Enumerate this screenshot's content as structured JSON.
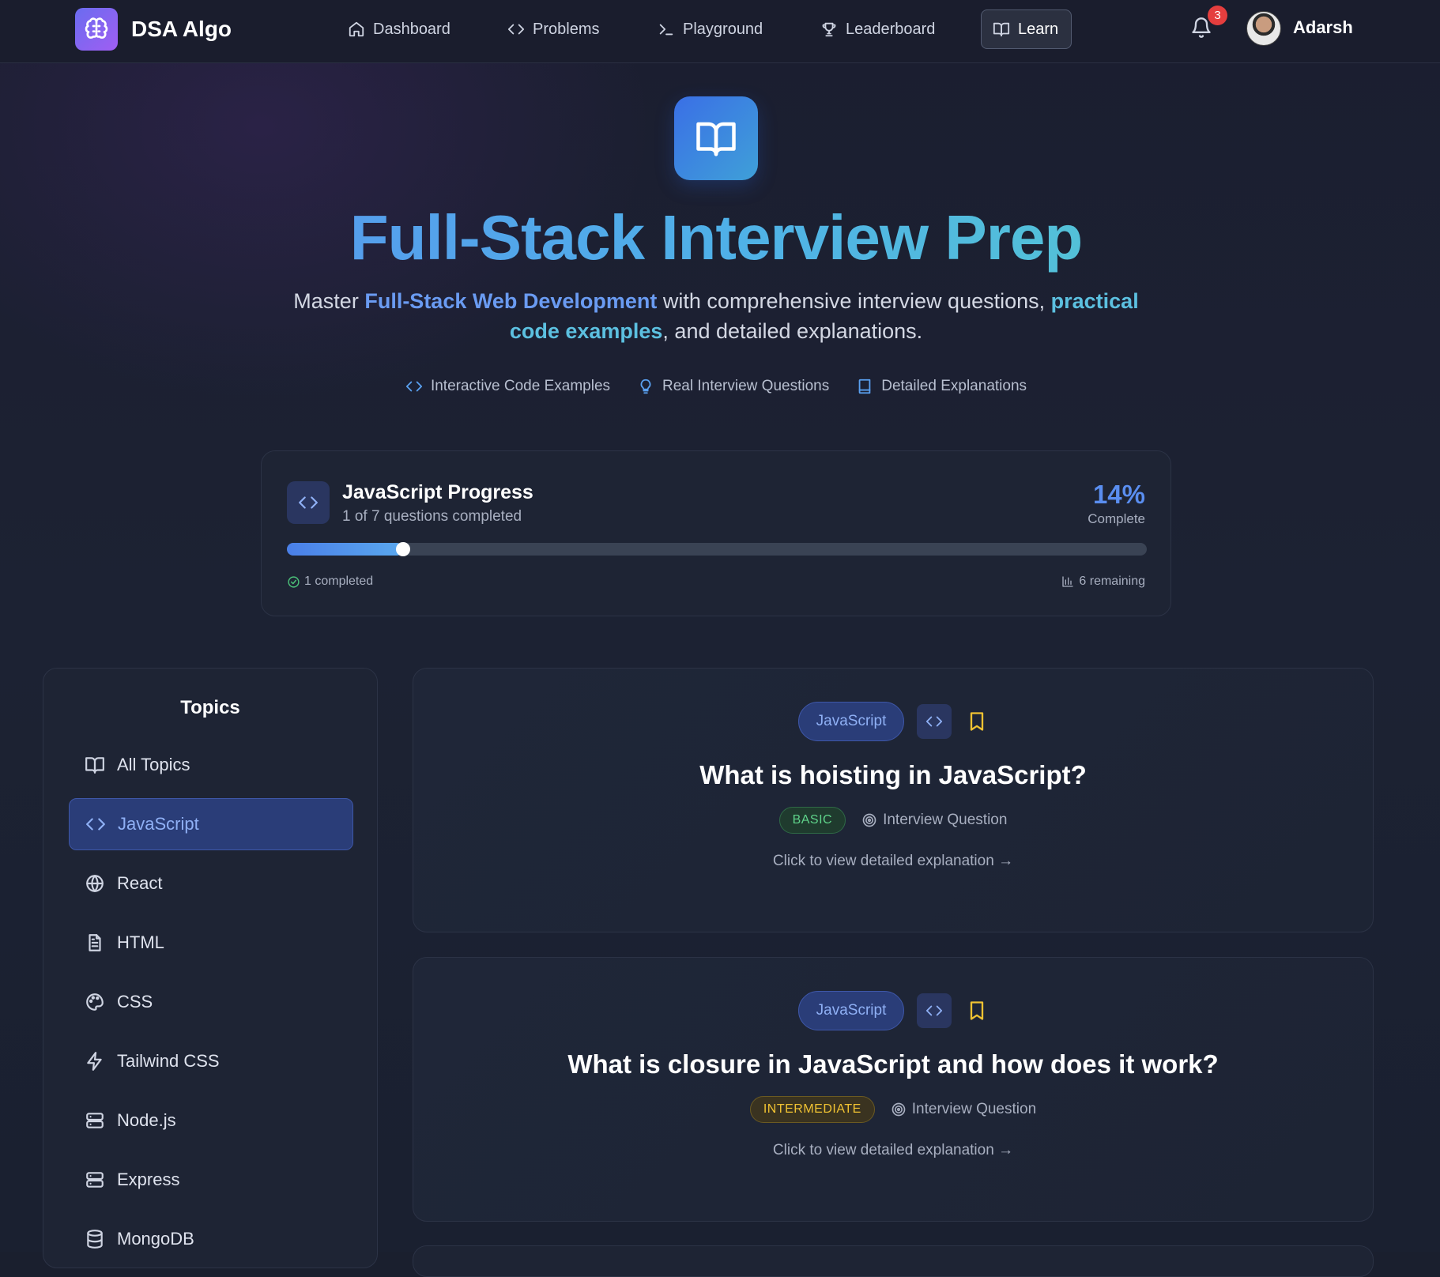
{
  "nav": {
    "brand": "DSA Algo",
    "items": [
      {
        "label": "Dashboard",
        "icon": "home-icon"
      },
      {
        "label": "Problems",
        "icon": "code-icon"
      },
      {
        "label": "Playground",
        "icon": "terminal-icon"
      },
      {
        "label": "Leaderboard",
        "icon": "trophy-icon"
      },
      {
        "label": "Learn",
        "icon": "book-open-icon",
        "active": true
      }
    ],
    "notification_count": "3",
    "user_name": "Adarsh"
  },
  "hero": {
    "title": "Full-Stack Interview Prep",
    "subtitle_pre": "Master ",
    "subtitle_hl1": "Full-Stack Web Development",
    "subtitle_mid": " with comprehensive interview questions, ",
    "subtitle_hl2": "practical code examples",
    "subtitle_post": ", and detailed explanations.",
    "features": [
      "Interactive Code Examples",
      "Real Interview Questions",
      "Detailed Explanations"
    ]
  },
  "progress": {
    "title": "JavaScript Progress",
    "subtitle": "1 of 7 questions completed",
    "percent_text": "14%",
    "percent_label": "Complete",
    "fraction": 0.135,
    "completed_text": "1 completed",
    "remaining_text": "6 remaining"
  },
  "sidebar": {
    "title": "Topics",
    "items": [
      {
        "label": "All Topics",
        "icon": "book-open-icon"
      },
      {
        "label": "JavaScript",
        "icon": "code-icon",
        "active": true
      },
      {
        "label": "React",
        "icon": "globe-icon"
      },
      {
        "label": "HTML",
        "icon": "file-text-icon"
      },
      {
        "label": "CSS",
        "icon": "palette-icon"
      },
      {
        "label": "Tailwind CSS",
        "icon": "zap-icon"
      },
      {
        "label": "Node.js",
        "icon": "server-icon"
      },
      {
        "label": "Express",
        "icon": "server-icon"
      },
      {
        "label": "MongoDB",
        "icon": "database-icon"
      }
    ]
  },
  "questions": [
    {
      "topic": "JavaScript",
      "title": "What is hoisting in JavaScript?",
      "level": "BASIC",
      "type": "Interview Question",
      "link": "Click to view detailed explanation →"
    },
    {
      "topic": "JavaScript",
      "title": "What is closure in JavaScript and how does it work?",
      "level": "INTERMEDIATE",
      "type": "Interview Question",
      "link": "Click to view detailed explanation →"
    }
  ],
  "colors": {
    "accent_blue": "#5a8ef0",
    "bookmark_yellow": "#f0c232",
    "basic_green": "#5fd38a",
    "intermediate_yellow": "#f0c232",
    "badge_red": "#e53e3e"
  }
}
